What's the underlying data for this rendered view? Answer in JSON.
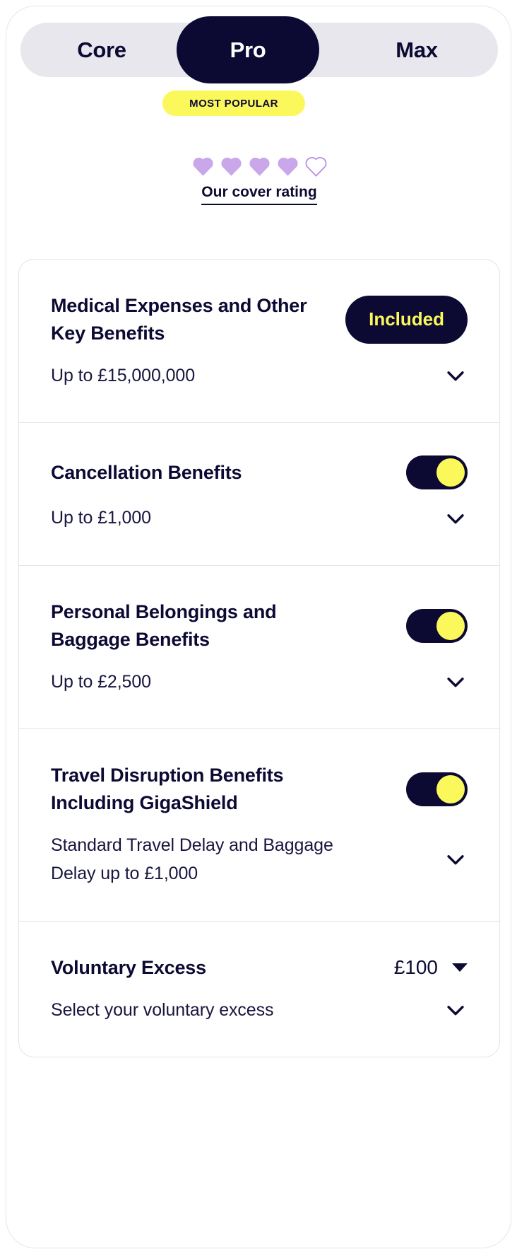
{
  "colors": {
    "ink": "#0c0a33",
    "yellow": "#fbf85c",
    "track": "#e7e7ed",
    "border": "#e4e4ea",
    "heart_filled": "#c9a7ea",
    "heart_empty_stroke": "#b98fe0"
  },
  "tiers": {
    "options": [
      {
        "label": "Core",
        "selected": false
      },
      {
        "label": "Pro",
        "selected": true
      },
      {
        "label": "Max",
        "selected": false
      }
    ],
    "core_label": "Core",
    "pro_label": "Pro",
    "max_label": "Max",
    "badge": "MOST POPULAR"
  },
  "rating": {
    "label": "Our cover rating",
    "filled": 4,
    "total": 5,
    "icon": "heart-icon"
  },
  "benefits": [
    {
      "title": "Medical Expenses and Other Key Benefits",
      "subtitle": "Up to £15,000,000",
      "control": "badge",
      "badge_label": "Included",
      "toggle_on": true,
      "expand_icon": "chevron-down-icon"
    },
    {
      "title": "Cancellation Benefits",
      "subtitle": "Up to £1,000",
      "control": "toggle",
      "badge_label": "",
      "toggle_on": true,
      "expand_icon": "chevron-down-icon"
    },
    {
      "title": "Personal Belongings and Baggage Benefits",
      "subtitle": "Up to £2,500",
      "control": "toggle",
      "badge_label": "",
      "toggle_on": true,
      "expand_icon": "chevron-down-icon"
    },
    {
      "title": "Travel Disruption Benefits Including GigaShield",
      "subtitle": "Standard Travel Delay and Baggage Delay up to £1,000",
      "control": "toggle",
      "badge_label": "",
      "toggle_on": true,
      "expand_icon": "chevron-down-icon"
    }
  ],
  "excess": {
    "title": "Voluntary Excess",
    "value": "£100",
    "subtitle": "Select your voluntary excess",
    "caret_icon": "caret-down-icon",
    "expand_icon": "chevron-down-icon"
  }
}
